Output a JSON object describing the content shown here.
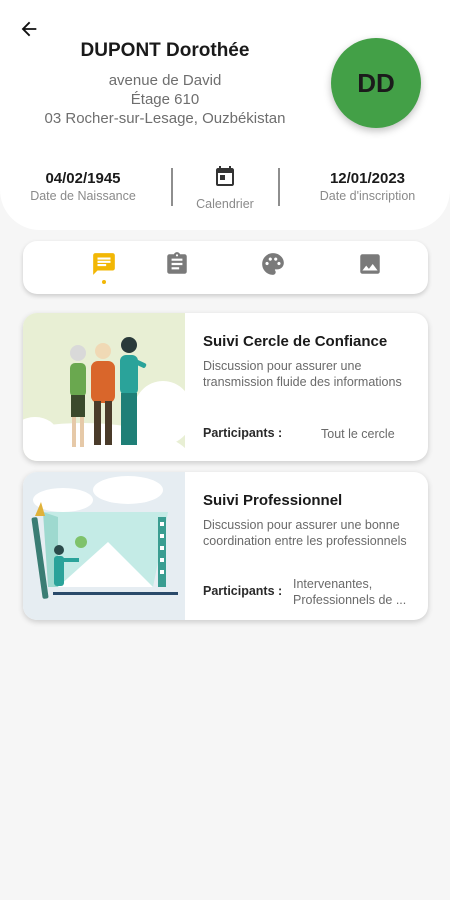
{
  "patient": {
    "name": "DUPONT Dorothée",
    "address_line1": "avenue de David",
    "address_line2": "Étage 610",
    "address_line3": "03 Rocher-sur-Lesage, Ouzbékistan",
    "initials": "DD",
    "avatar_color": "#43a047"
  },
  "stats": {
    "birth_date": "04/02/1945",
    "birth_label": "Date de Naissance",
    "calendar_label": "Calendrier",
    "signup_date": "12/01/2023",
    "signup_label": "Date d'inscription"
  },
  "tabs": [
    {
      "icon": "chat-icon",
      "active": true
    },
    {
      "icon": "clipboard-icon",
      "active": false
    },
    {
      "icon": "palette-icon",
      "active": false
    },
    {
      "icon": "image-icon",
      "active": false
    }
  ],
  "accent_color": "#f2b705",
  "cards": [
    {
      "title": "Suivi Cercle de Confiance",
      "description": "Discussion pour assurer une transmission fluide des informations",
      "participants_label": "Participants :",
      "participants": "Tout le cercle"
    },
    {
      "title": "Suivi Professionnel",
      "description": "Discussion pour assurer une bonne coordination entre les professionnels",
      "participants_label": "Participants :",
      "participants": "Intervenantes, Professionnels de ..."
    }
  ]
}
